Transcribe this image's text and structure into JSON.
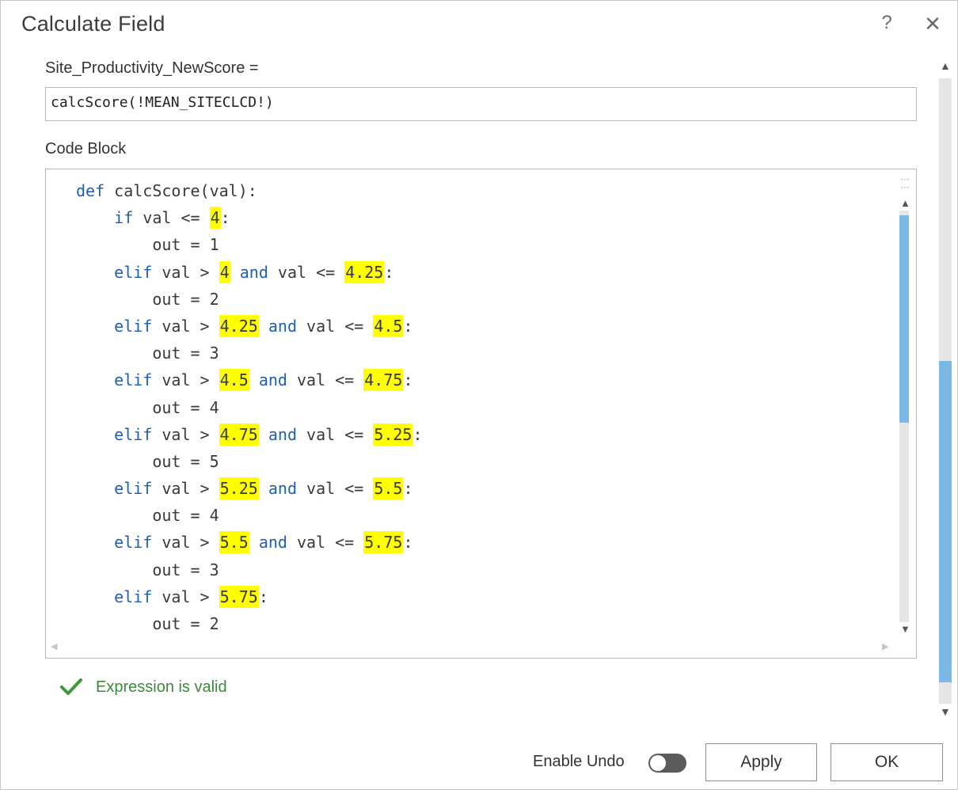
{
  "dialog": {
    "title": "Calculate Field",
    "help_label": "?",
    "close_label": "✕"
  },
  "expression": {
    "field_label": "Site_Productivity_NewScore =",
    "value": "calcScore(!MEAN_SITECLCD!)"
  },
  "code_block": {
    "label": "Code Block",
    "lines": [
      [
        {
          "t": "def",
          "k": 1
        },
        {
          "t": " calcScore(val):"
        }
      ],
      [
        {
          "t": "    "
        },
        {
          "t": "if",
          "k": 1
        },
        {
          "t": " val <= "
        },
        {
          "t": "4",
          "h": 1
        },
        {
          "t": ":"
        }
      ],
      [
        {
          "t": "        out = 1"
        }
      ],
      [
        {
          "t": "    "
        },
        {
          "t": "elif",
          "k": 1
        },
        {
          "t": " val > "
        },
        {
          "t": "4",
          "h": 1
        },
        {
          "t": " "
        },
        {
          "t": "and",
          "k": 1
        },
        {
          "t": " val <= "
        },
        {
          "t": "4.25",
          "h": 1
        },
        {
          "t": ":"
        }
      ],
      [
        {
          "t": "        out = 2"
        }
      ],
      [
        {
          "t": "    "
        },
        {
          "t": "elif",
          "k": 1
        },
        {
          "t": " val > "
        },
        {
          "t": "4.25",
          "h": 1
        },
        {
          "t": " "
        },
        {
          "t": "and",
          "k": 1
        },
        {
          "t": " val <= "
        },
        {
          "t": "4.5",
          "h": 1
        },
        {
          "t": ":"
        }
      ],
      [
        {
          "t": "        out = 3"
        }
      ],
      [
        {
          "t": "    "
        },
        {
          "t": "elif",
          "k": 1
        },
        {
          "t": " val > "
        },
        {
          "t": "4.5",
          "h": 1
        },
        {
          "t": " "
        },
        {
          "t": "and",
          "k": 1
        },
        {
          "t": " val <= "
        },
        {
          "t": "4.75",
          "h": 1
        },
        {
          "t": ":"
        }
      ],
      [
        {
          "t": "        out = 4"
        }
      ],
      [
        {
          "t": "    "
        },
        {
          "t": "elif",
          "k": 1
        },
        {
          "t": " val > "
        },
        {
          "t": "4.75",
          "h": 1
        },
        {
          "t": " "
        },
        {
          "t": "and",
          "k": 1
        },
        {
          "t": " val <= "
        },
        {
          "t": "5.25",
          "h": 1
        },
        {
          "t": ":"
        }
      ],
      [
        {
          "t": "        out = 5"
        }
      ],
      [
        {
          "t": "    "
        },
        {
          "t": "elif",
          "k": 1
        },
        {
          "t": " val > "
        },
        {
          "t": "5.25",
          "h": 1
        },
        {
          "t": " "
        },
        {
          "t": "and",
          "k": 1
        },
        {
          "t": " val <= "
        },
        {
          "t": "5.5",
          "h": 1
        },
        {
          "t": ":"
        }
      ],
      [
        {
          "t": "        out = 4"
        }
      ],
      [
        {
          "t": "    "
        },
        {
          "t": "elif",
          "k": 1
        },
        {
          "t": " val > "
        },
        {
          "t": "5.5",
          "h": 1
        },
        {
          "t": " "
        },
        {
          "t": "and",
          "k": 1
        },
        {
          "t": " val <= "
        },
        {
          "t": "5.75",
          "h": 1
        },
        {
          "t": ":"
        }
      ],
      [
        {
          "t": "        out = 3"
        }
      ],
      [
        {
          "t": "    "
        },
        {
          "t": "elif",
          "k": 1
        },
        {
          "t": " val > "
        },
        {
          "t": "5.75",
          "h": 1
        },
        {
          "t": ":"
        }
      ],
      [
        {
          "t": "        out = 2"
        }
      ]
    ]
  },
  "validation": {
    "message": "Expression is valid",
    "icon": "checkmark-icon",
    "color": "#3a8a3a"
  },
  "footer": {
    "enable_undo_label": "Enable Undo",
    "enable_undo_on": false,
    "apply_label": "Apply",
    "ok_label": "OK"
  },
  "colors": {
    "keyword": "#1f5fb5",
    "highlight": "#ffff00",
    "scroll_thumb": "#7ab9e5"
  }
}
